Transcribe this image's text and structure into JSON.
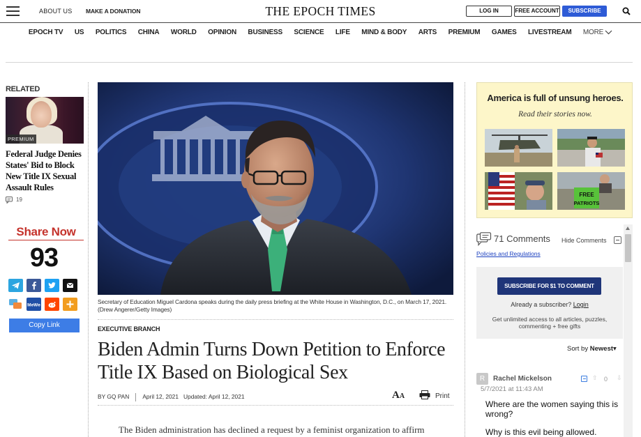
{
  "header": {
    "about": "ABOUT US",
    "donate": "MAKE A DONATION",
    "logo": "THE EPOCH TIMES",
    "login": "LOG IN",
    "free_account": "FREE ACCOUNT",
    "subscribe": "SUBSCRIBE"
  },
  "nav": {
    "items": [
      "EPOCH TV",
      "US",
      "POLITICS",
      "CHINA",
      "WORLD",
      "OPINION",
      "BUSINESS",
      "SCIENCE",
      "LIFE",
      "MIND & BODY",
      "ARTS",
      "PREMIUM",
      "GAMES",
      "LIVESTREAM"
    ],
    "more": "MORE"
  },
  "related": {
    "heading": "RELATED",
    "badge": "PREMIUM",
    "title": "Federal Judge Denies States' Bid to Block New Title IX Sexual Assault Rules",
    "comments": "19"
  },
  "share": {
    "heading": "Share Now",
    "count": "93",
    "copy_link": "Copy Link",
    "buttons": [
      "telegram-icon",
      "facebook-icon",
      "twitter-icon",
      "email-icon",
      "gab-icon",
      "mewe-icon",
      "reddit-icon",
      "more-share-icon"
    ]
  },
  "article": {
    "caption": "Secretary of Education Miguel Cardona speaks during the daily press briefing at the White House in Washington, D.C., on March 17, 2021. (Drew Angerer/Getty Images)",
    "section": "EXECUTIVE BRANCH",
    "headline": "Biden Admin Turns Down Petition to Enforce Title IX Based on Biological Sex",
    "byline_author": "BY GQ PAN",
    "date": "April 12, 2021",
    "updated": "Updated: April 12, 2021",
    "print": "Print",
    "body_start": "The Biden administration has declined a request by a feminist organization to affirm"
  },
  "ad": {
    "headline": "America is full of unsung heroes.",
    "subline": "Read their stories now."
  },
  "comments": {
    "count_label": "71 Comments",
    "hide_label": "Hide Comments",
    "policies": "Policies and Regulations",
    "subscribe_button": "SUBSCRIBE FOR $1 TO COMMENT",
    "already": "Already a subscriber?",
    "login": "Login",
    "access": "Get unlimited access to all articles, puzzles, commenting + free gifts",
    "sort_label": "Sort by",
    "sort_value": "Newest",
    "first": {
      "initial": "R",
      "author": "Rachel Mickelson",
      "date": "5/7/2021 at 11:43 AM",
      "votes": "0",
      "text1": "Where are the women saying this is wrong?",
      "text2": "Why is this evil being allowed."
    }
  },
  "colors": {
    "subscribe_blue": "#2e5bd6",
    "share_red": "#c5332c",
    "copy_link_blue": "#3d7de6",
    "comment_button_navy": "#1f3579",
    "ad_background": "#fdf6c9"
  }
}
